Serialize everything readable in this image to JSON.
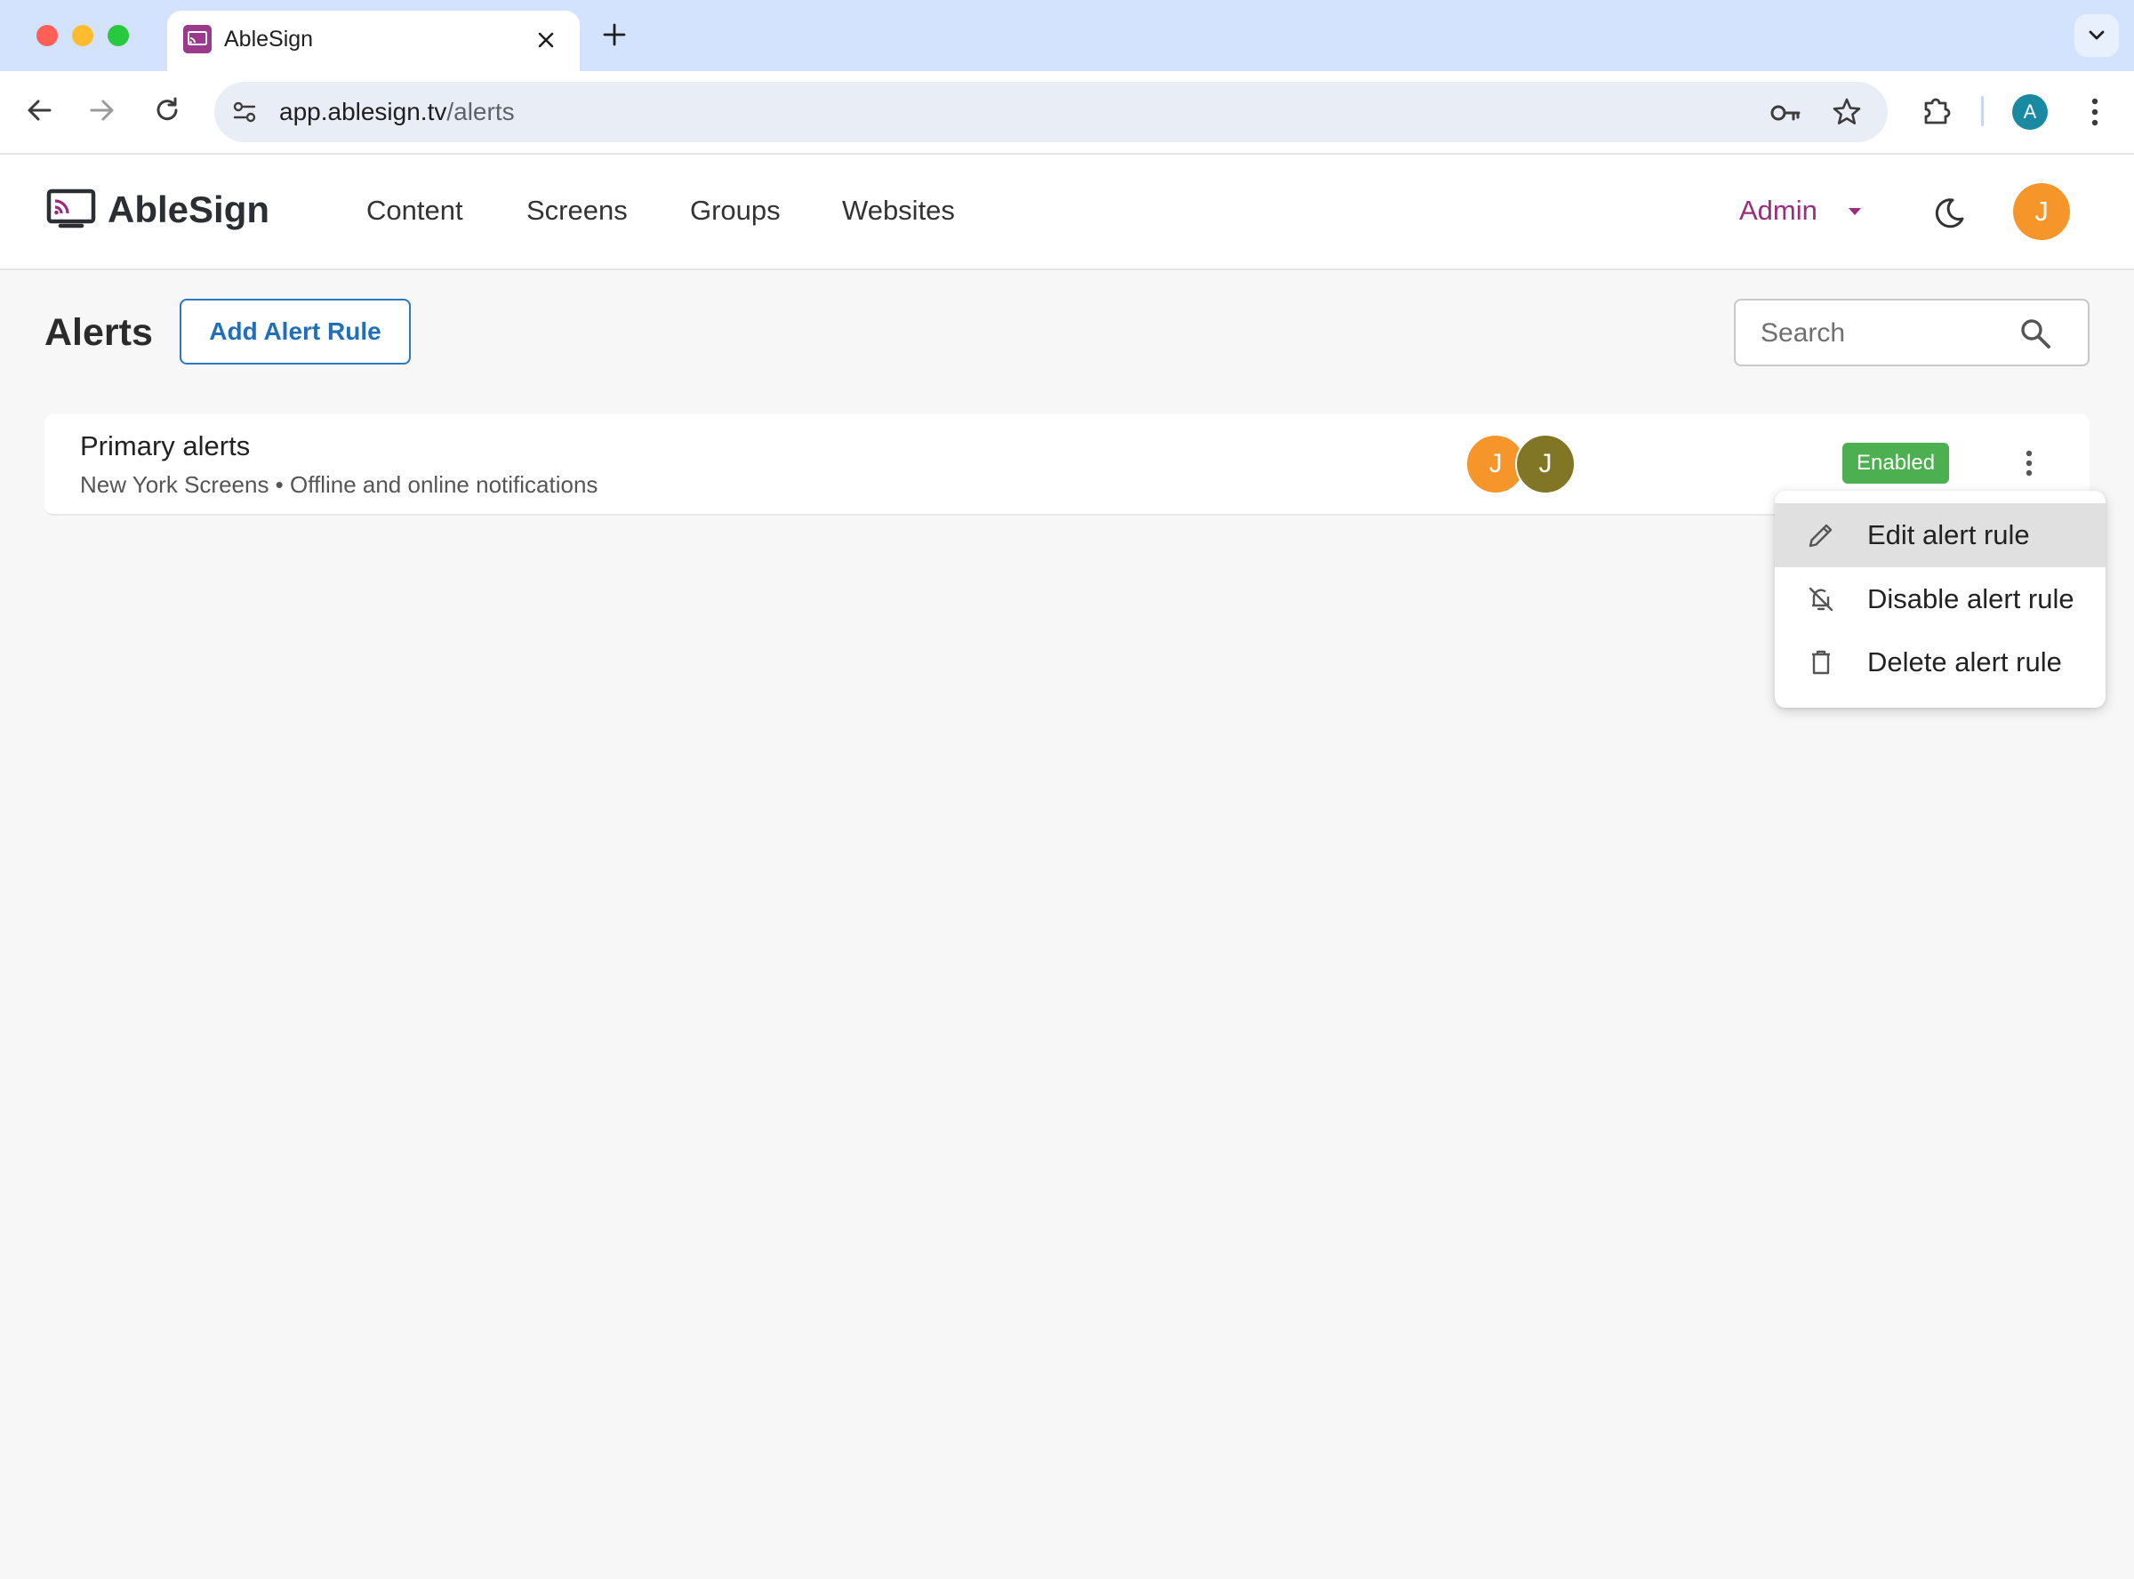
{
  "browser": {
    "tab_title": "AbleSign",
    "url_host": "app.ablesign.tv",
    "url_path": "/alerts",
    "profile_initial": "A"
  },
  "app": {
    "logo_text": "AbleSign",
    "nav": {
      "content": "Content",
      "screens": "Screens",
      "groups": "Groups",
      "websites": "Websites"
    },
    "role": "Admin",
    "user_initial": "J"
  },
  "page": {
    "title": "Alerts",
    "add_button": "Add Alert Rule",
    "search_placeholder": "Search"
  },
  "alert_rules": [
    {
      "name": "Primary alerts",
      "description": "New York Screens • Offline and online notifications",
      "recipients": [
        "J",
        "J"
      ],
      "status": "Enabled"
    }
  ],
  "context_menu": {
    "edit": "Edit alert rule",
    "disable": "Disable alert rule",
    "delete": "Delete alert rule"
  },
  "colors": {
    "accent": "#1f6fba",
    "role": "#9b2d7f",
    "status_enabled": "#4caf50",
    "avatar_orange": "#f5952a",
    "avatar_olive": "#807626"
  },
  "icons": [
    "search-icon",
    "moon-icon",
    "pencil-icon",
    "bell-off-icon",
    "trash-icon",
    "more-vert-icon"
  ]
}
